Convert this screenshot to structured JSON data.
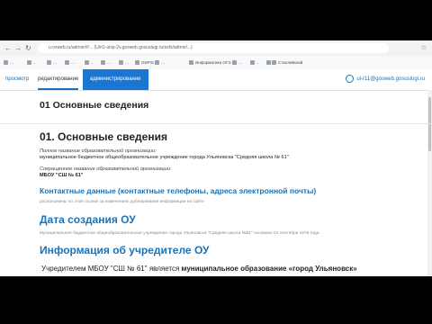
{
  "browser": {
    "url": "u.osweb.ru/admin/#/... (U/n1-ulsp-2v.gosweb.gosuslugi.ru/ssfs/admin/...)",
    "bookmarks": [
      "...",
      "...",
      "...",
      "...",
      "...",
      "...",
      "...",
      "OSPIS",
      "...",
      "Информатика ОГЭ",
      "...",
      "...",
      "...",
      "Сталлийский"
    ]
  },
  "toolbar": {
    "view_label": "просмотр",
    "edit_label": "редактирование",
    "admin_label": "администрирование",
    "user_email": "ul-r11@gosweb.gosuslugi.ru"
  },
  "page": {
    "header_title": "01 Основные сведения",
    "section_title": "01. Основные сведения",
    "full_name_label": "Полное название образовательной организации:",
    "full_name_value": "муниципальное бюджетное общеобразовательное учреждение города Ульяновска \"Средняя школа № 61\"",
    "short_name_label": "Сокращенное название образовательной организации:",
    "short_name_value": "МБОУ \"СШ № 61\"",
    "contacts_title": "Контактные данные (контактные телефоны, адреса электронной почты)",
    "contacts_note": "расположены по этой ссылке за изменениях дублирования информации на сайте",
    "creation_title": "Дата создания ОУ",
    "creation_text": "Муниципальное бюджетное общеобразовательное учреждение города Ульяновска \"Средняя школа №61\" основано 01 сентября 1976 года.",
    "founder_title": "Информация об учредителе ОУ",
    "founder_text_a": "Учредителем МБОУ \"СШ № 61\" является",
    "founder_text_b": "муниципальное образование «город Ульяновск»"
  }
}
